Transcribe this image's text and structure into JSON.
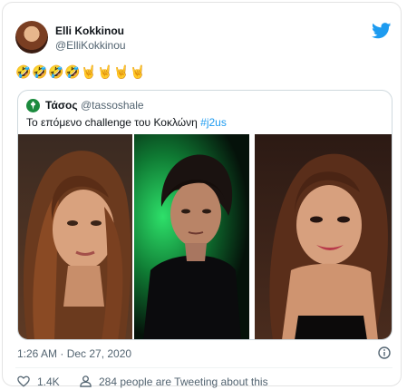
{
  "author": {
    "display_name": "Elli Kokkinou",
    "handle": "@ElliKokkinou"
  },
  "emoji_row": [
    "🤣",
    "🤣",
    "🤣",
    "🤣",
    "🤘",
    "🤘",
    "🤘",
    "🤘"
  ],
  "quoted_tweet": {
    "display_name": "Τάσος",
    "handle": "@tassoshale",
    "text": "Το επόμενο challenge του Κοκλώνη ",
    "hashtag": "#j2us"
  },
  "footer": {
    "timestamp": "1:26 AM · Dec 27, 2020",
    "like_count": "1.4K",
    "people_text": "284 people are Tweeting about this"
  },
  "colors": {
    "link": "#1d9bf0",
    "muted": "#536471",
    "twitter_blue": "#1d9bf0"
  },
  "icons": [
    "twitter-logo-icon",
    "info-icon",
    "heart-icon",
    "people-icon",
    "club-logo-icon"
  ]
}
